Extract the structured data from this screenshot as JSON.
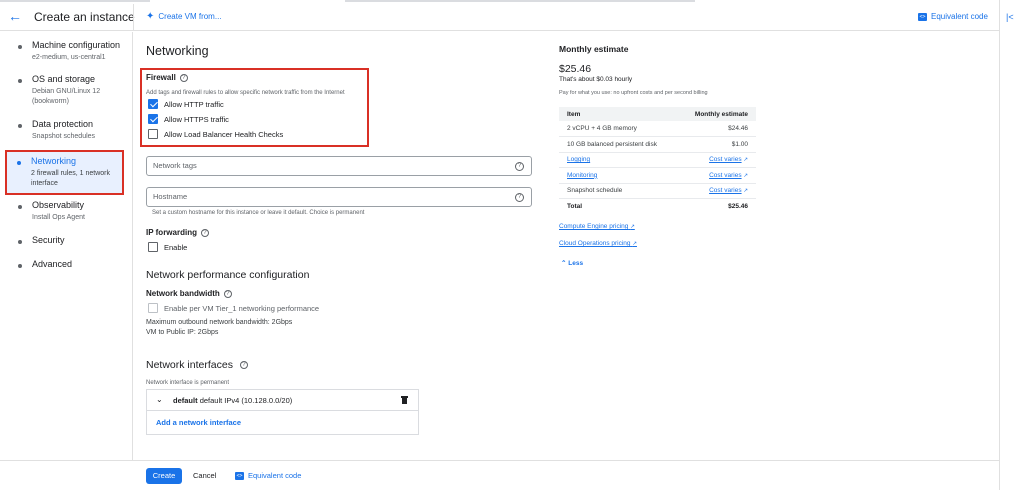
{
  "header": {
    "title": "Create an instance",
    "create_vm_from": "Create VM from...",
    "equivalent_code": "Equivalent code"
  },
  "sidebar": {
    "items": [
      {
        "label": "Machine configuration",
        "sub": "e2-medium, us-central1"
      },
      {
        "label": "OS and storage",
        "sub": "Debian GNU/Linux 12 (bookworm)"
      },
      {
        "label": "Data protection",
        "sub": "Snapshot schedules"
      },
      {
        "label": "Networking",
        "sub": "2 firewall rules, 1 network interface"
      },
      {
        "label": "Observability",
        "sub": "Install Ops Agent"
      },
      {
        "label": "Security",
        "sub": ""
      },
      {
        "label": "Advanced",
        "sub": ""
      }
    ]
  },
  "networking": {
    "title": "Networking",
    "firewall": {
      "label": "Firewall",
      "description": "Add tags and firewall rules to allow specific network traffic from the Internet",
      "options": [
        {
          "label": "Allow HTTP traffic",
          "checked": true
        },
        {
          "label": "Allow HTTPS traffic",
          "checked": true
        },
        {
          "label": "Allow Load Balancer Health Checks",
          "checked": false
        }
      ]
    },
    "network_tags": {
      "placeholder": "Network tags"
    },
    "hostname": {
      "placeholder": "Hostname",
      "hint": "Set a custom hostname for this instance or leave it default. Choice is permanent"
    },
    "ip_forwarding": {
      "label": "IP forwarding",
      "enable": "Enable",
      "checked": false
    },
    "perf": {
      "title": "Network performance configuration",
      "bandwidth_label": "Network bandwidth",
      "tier1": "Enable per VM Tier_1 networking performance",
      "max_outbound": "Maximum outbound network bandwidth: 2Gbps",
      "vm_public": "VM to Public IP: 2Gbps"
    },
    "interfaces": {
      "title": "Network interfaces",
      "permanent": "Network interface is permanent",
      "row_name": "default",
      "row_detail": "default IPv4 (10.128.0.0/20)",
      "add": "Add a network interface"
    }
  },
  "footer": {
    "create": "Create",
    "cancel": "Cancel",
    "equivalent_code": "Equivalent code"
  },
  "estimate": {
    "title": "Monthly estimate",
    "price": "$25.46",
    "hourly": "That's about $0.03 hourly",
    "upfront": "Pay for what you use: no upfront costs and per second billing",
    "col_item": "Item",
    "col_estimate": "Monthly estimate",
    "rows": [
      {
        "item": "2 vCPU + 4 GB memory",
        "value": "$24.46"
      },
      {
        "item": "10 GB balanced persistent disk",
        "value": "$1.00"
      },
      {
        "item": "Logging",
        "value": "Cost varies"
      },
      {
        "item": "Monitoring",
        "value": "Cost varies"
      },
      {
        "item": "Snapshot schedule",
        "value": "Cost varies"
      },
      {
        "item": "Total",
        "value": "$25.46"
      }
    ],
    "compute_pricing": "Compute Engine pricing",
    "ops_pricing": "Cloud Operations pricing",
    "less": "Less"
  }
}
